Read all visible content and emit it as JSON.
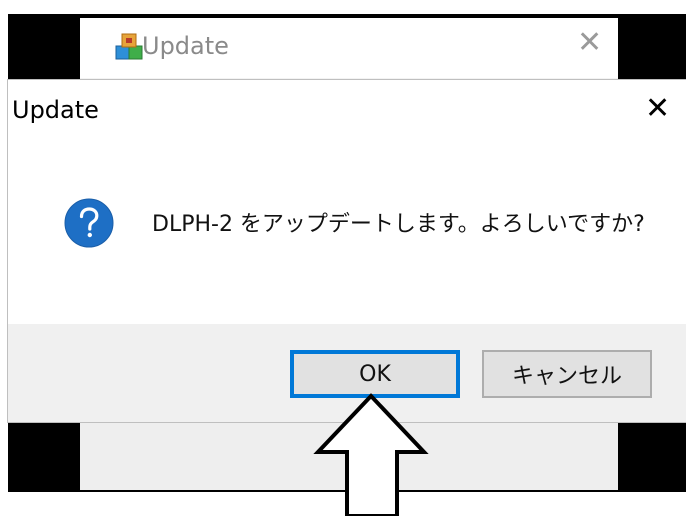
{
  "background_window": {
    "title": "Update",
    "close_glyph": "✕"
  },
  "dialog": {
    "title": "Update",
    "close_glyph": "✕",
    "icon": "question-icon",
    "message": "DLPH-2  をアップデートします。よろしいですか?",
    "buttons": {
      "ok_label": "OK",
      "cancel_label": "キャンセル"
    }
  },
  "colors": {
    "accent": "#0078d7",
    "question_icon": "#1e6fc5"
  }
}
